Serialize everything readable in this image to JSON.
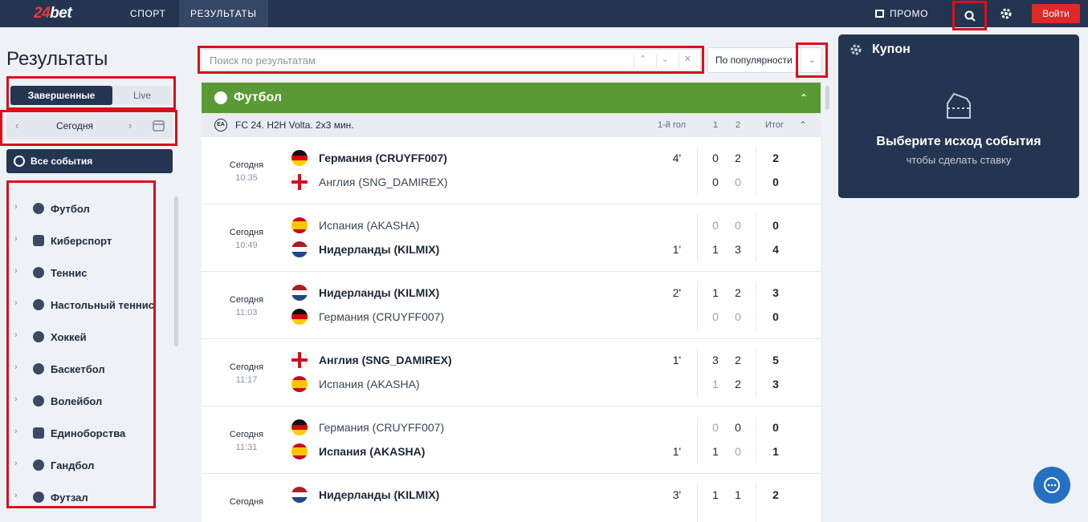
{
  "header": {
    "logo_num": "24",
    "logo_text": "bet",
    "nav": [
      "СПОРТ",
      "РЕЗУЛЬТАТЫ"
    ],
    "promo": "ПРОМО",
    "login": "Войти"
  },
  "sidebar": {
    "title": "Результаты",
    "tabs": {
      "finished": "Завершенные",
      "live": "Live"
    },
    "date": "Сегодня",
    "all_events": "Все события",
    "sports": [
      "Футбол",
      "Киберспорт",
      "Теннис",
      "Настольный теннис",
      "Хоккей",
      "Баскетбол",
      "Волейбол",
      "Единоборства",
      "Гандбол",
      "Футзал"
    ]
  },
  "search": {
    "placeholder": "Поиск по результатам"
  },
  "sort": {
    "value": "По популярности"
  },
  "sport_header": "Футбол",
  "league": {
    "name": "FC 24. H2H Volta. 2x3 мин.",
    "icon": "EA",
    "cols": {
      "first_goal": "1-й гол",
      "p1": "1",
      "p2": "2",
      "total": "Итог"
    }
  },
  "matches": [
    {
      "day": "Сегодня",
      "time": "10:35",
      "teams": [
        {
          "name": "Германия (CRUYFF007)",
          "flag": "germany",
          "winner": true,
          "fg": "4'",
          "s1": "0",
          "s2": "2",
          "total": "2",
          "dim": [
            false,
            false
          ]
        },
        {
          "name": "Англия (SNG_DAMIREX)",
          "flag": "england",
          "winner": false,
          "fg": "",
          "s1": "0",
          "s2": "0",
          "total": "0",
          "dim": [
            false,
            true
          ]
        }
      ]
    },
    {
      "day": "Сегодня",
      "time": "10:49",
      "teams": [
        {
          "name": "Испания (AKASHA)",
          "flag": "spain",
          "winner": false,
          "fg": "",
          "s1": "0",
          "s2": "0",
          "total": "0",
          "dim": [
            true,
            true
          ]
        },
        {
          "name": "Нидерланды (KILMIX)",
          "flag": "netherlands",
          "winner": true,
          "fg": "1'",
          "s1": "1",
          "s2": "3",
          "total": "4",
          "dim": [
            false,
            false
          ]
        }
      ]
    },
    {
      "day": "Сегодня",
      "time": "11:03",
      "teams": [
        {
          "name": "Нидерланды (KILMIX)",
          "flag": "netherlands",
          "winner": true,
          "fg": "2'",
          "s1": "1",
          "s2": "2",
          "total": "3",
          "dim": [
            false,
            false
          ]
        },
        {
          "name": "Германия (CRUYFF007)",
          "flag": "germany",
          "winner": false,
          "fg": "",
          "s1": "0",
          "s2": "0",
          "total": "0",
          "dim": [
            true,
            true
          ]
        }
      ]
    },
    {
      "day": "Сегодня",
      "time": "11:17",
      "teams": [
        {
          "name": "Англия (SNG_DAMIREX)",
          "flag": "england",
          "winner": true,
          "fg": "1'",
          "s1": "3",
          "s2": "2",
          "total": "5",
          "dim": [
            false,
            false
          ]
        },
        {
          "name": "Испания (AKASHA)",
          "flag": "spain",
          "winner": false,
          "fg": "",
          "s1": "1",
          "s2": "2",
          "total": "3",
          "dim": [
            true,
            false
          ]
        }
      ]
    },
    {
      "day": "Сегодня",
      "time": "11:31",
      "teams": [
        {
          "name": "Германия (CRUYFF007)",
          "flag": "germany",
          "winner": false,
          "fg": "",
          "s1": "0",
          "s2": "0",
          "total": "0",
          "dim": [
            true,
            false
          ]
        },
        {
          "name": "Испания (AKASHA)",
          "flag": "spain",
          "winner": true,
          "fg": "1'",
          "s1": "1",
          "s2": "0",
          "total": "1",
          "dim": [
            false,
            true
          ]
        }
      ]
    },
    {
      "day": "Сегодня",
      "time": "",
      "teams": [
        {
          "name": "Нидерланды (KILMIX)",
          "flag": "netherlands",
          "winner": true,
          "fg": "3'",
          "s1": "1",
          "s2": "1",
          "total": "2",
          "dim": [
            false,
            false
          ]
        }
      ]
    }
  ],
  "coupon": {
    "title": "Купон",
    "empty_title": "Выберите исход события",
    "empty_sub": "чтобы сделать ставку"
  },
  "colors": {
    "accent_red": "#d8101c",
    "navy": "#243552",
    "green": "#5a9a34"
  }
}
